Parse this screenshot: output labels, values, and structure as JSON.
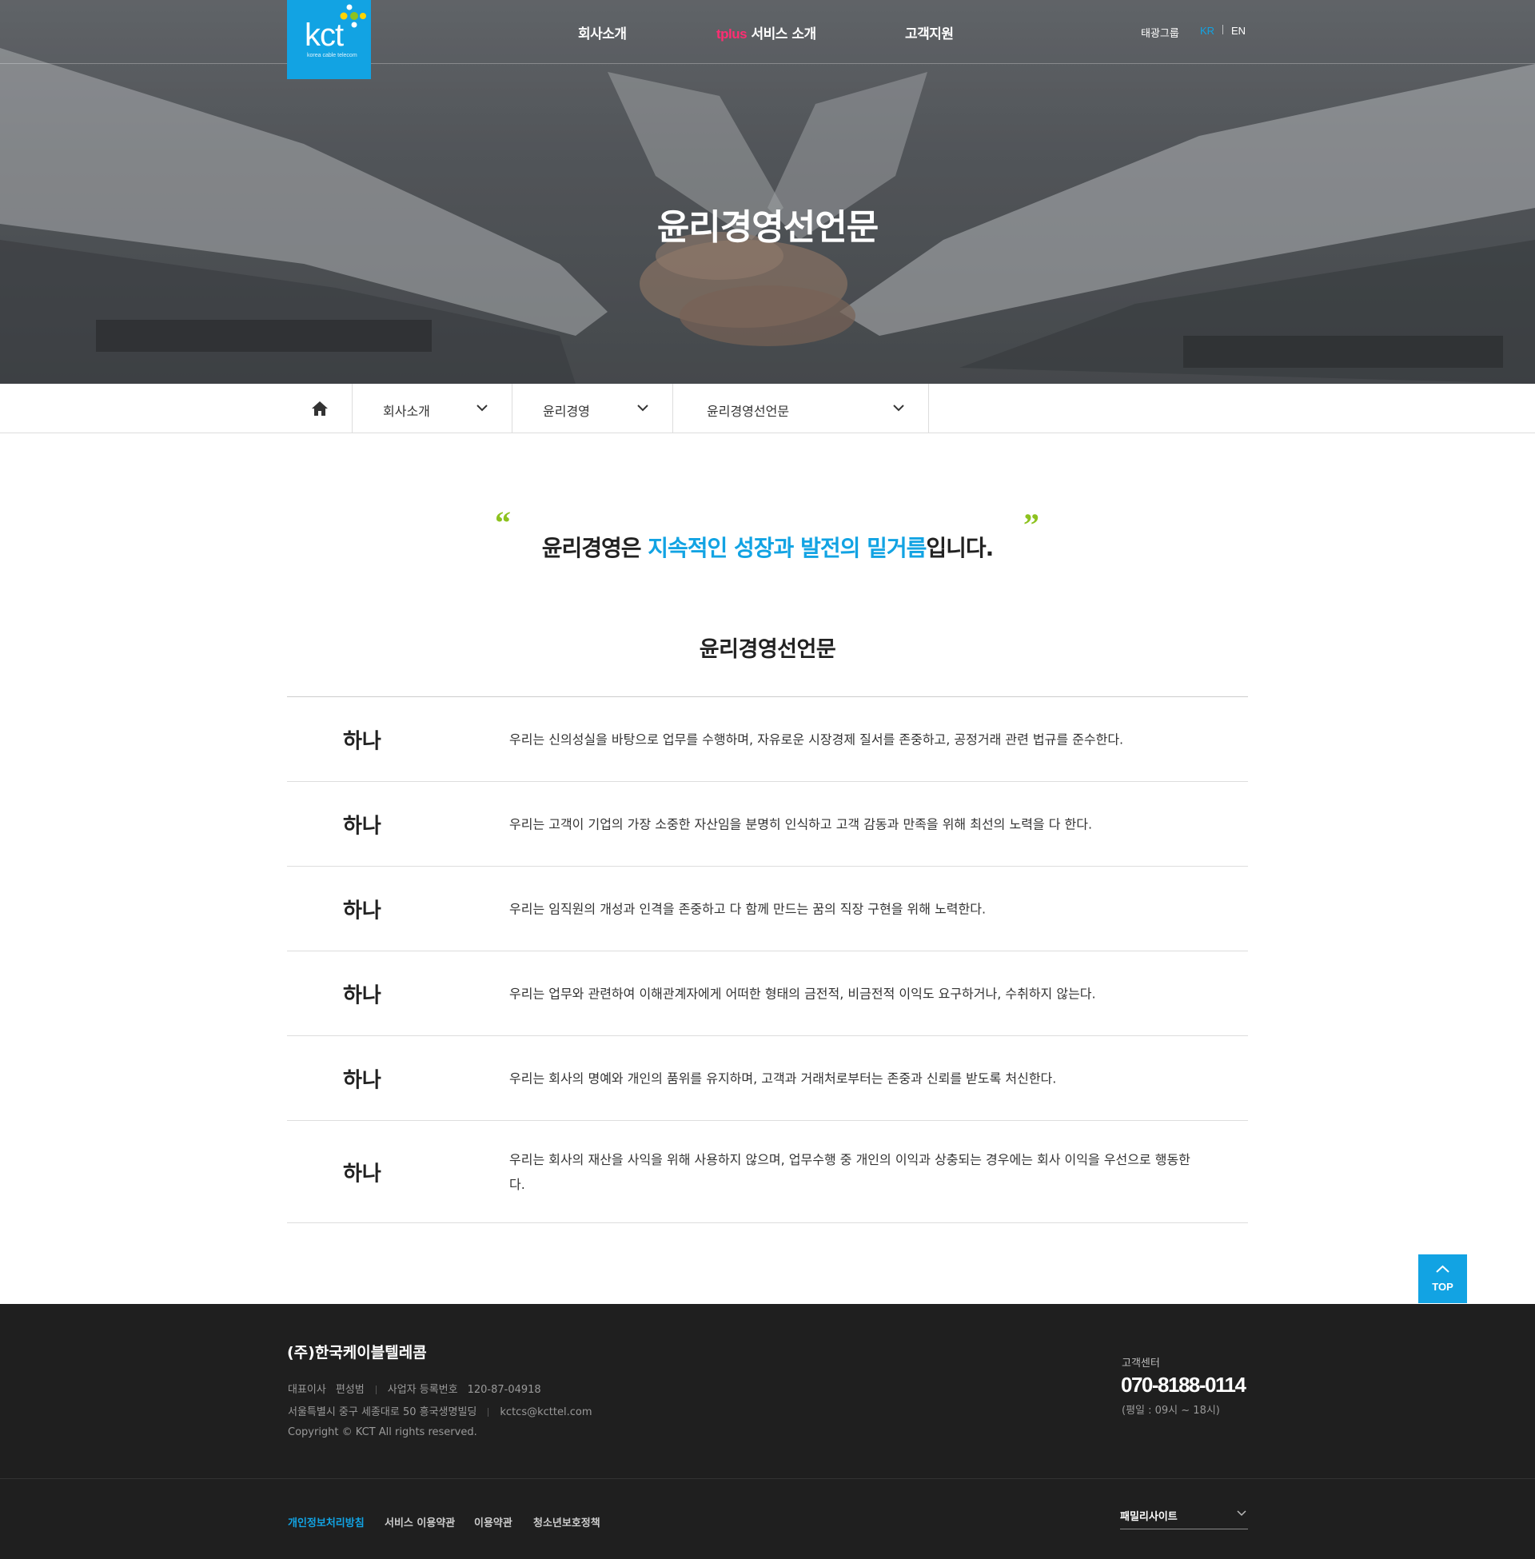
{
  "header": {
    "logo_text": "kct",
    "logo_sub": "korea cable telecom",
    "nav": [
      {
        "label": "회사소개"
      },
      {
        "brand": "tplus",
        "label": " 서비스 소개"
      },
      {
        "label": "고객지원"
      }
    ],
    "util": {
      "group": "태광그룹",
      "kr": "KR",
      "en": "EN"
    }
  },
  "hero": {
    "title": "윤리경영선언문"
  },
  "breadcrumb": [
    {
      "label": "회사소개"
    },
    {
      "label": "윤리경영"
    },
    {
      "label": "윤리경영선언문"
    }
  ],
  "quote": {
    "open": "“",
    "close": "”",
    "pre": "윤리경영은 ",
    "highlight": "지속적인 성장과 발전의 밑거름",
    "post": "입니다."
  },
  "section_title": "윤리경영선언문",
  "declarations": [
    {
      "key": "하나",
      "text": "우리는 신의성실을 바탕으로 업무를 수행하며, 자유로운 시장경제 질서를 존중하고, 공정거래 관련 법규를 준수한다."
    },
    {
      "key": "하나",
      "text": "우리는 고객이 기업의 가장 소중한 자산임을 분명히 인식하고 고객 감동과 만족을 위해 최선의 노력을 다 한다."
    },
    {
      "key": "하나",
      "text": "우리는 임직원의 개성과 인격을 존중하고 다 함께 만드는 꿈의 직장 구현을 위해 노력한다."
    },
    {
      "key": "하나",
      "text": "우리는 업무와 관련하여 이해관계자에게 어떠한 형태의 금전적, 비금전적 이익도 요구하거나, 수취하지 않는다."
    },
    {
      "key": "하나",
      "text": "우리는 회사의 명예와 개인의 품위를 유지하며, 고객과 거래처로부터는 존중과 신뢰를 받도록 처신한다."
    },
    {
      "key": "하나",
      "text": "우리는 회사의 재산을 사익을 위해 사용하지 않으며, 업무수행 중 개인의 이익과 상충되는 경우에는 회사 이익을 우선으로 행동한다."
    }
  ],
  "top_button": "TOP",
  "footer": {
    "company": "(주)한국케이블텔레콤",
    "ceo_label": "대표이사",
    "ceo": "편성범",
    "biz_label": "사업자 등록번호",
    "biz_no": "120-87-04918",
    "address": "서울특별시 중구 세종대로 50 흥국생명빌딩",
    "email": "kctcs@kcttel.com",
    "copyright": "Copyright © KCT All rights reserved.",
    "cs_label": "고객센터",
    "phone": "070-8188-0114",
    "hours": "(평일 : 09시 ~ 18시)",
    "links": [
      "개인정보처리방침",
      "서비스 이용약관",
      "이용약관",
      "청소년보호정책"
    ],
    "family_site": "패밀리사이트"
  },
  "colors": {
    "accent": "#12a3e3",
    "quote_mark": "#8dc21f",
    "tplus": "#ff2d72",
    "footer_bg": "#1f1f1f"
  }
}
